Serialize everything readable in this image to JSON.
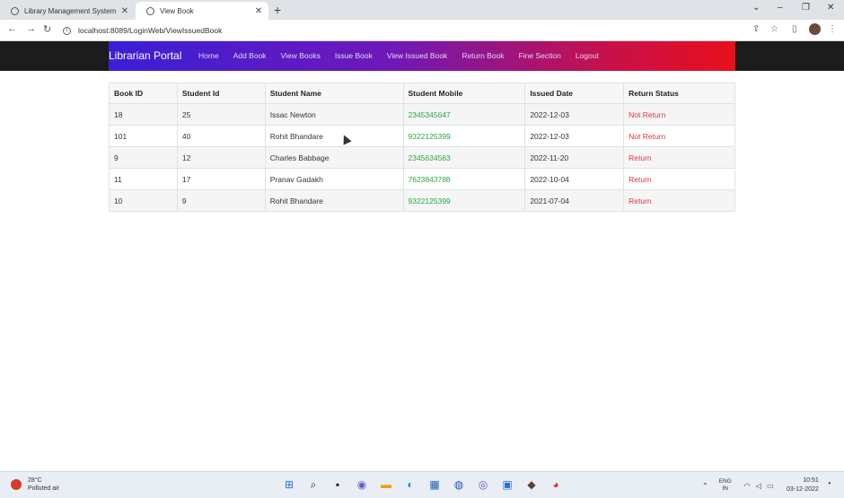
{
  "browser": {
    "tabs": [
      {
        "title": "Library Management System",
        "active": false
      },
      {
        "title": "View Book",
        "active": true
      }
    ],
    "url": "localhost:8089/LoginWeb/ViewIssuedBook"
  },
  "nav": {
    "brand": "Librarian Portal",
    "links": [
      "Home",
      "Add Book",
      "View Books",
      "Issue Book",
      "View Issued Book",
      "Return Book",
      "Fine Section",
      "Logout"
    ]
  },
  "table": {
    "headers": [
      "Book ID",
      "Student Id",
      "Student Name",
      "Student Mobile",
      "Issued Date",
      "Return Status"
    ],
    "rows": [
      [
        "18",
        "25",
        "Issac Newton",
        "2345345647",
        "2022-12-03",
        "Not Return"
      ],
      [
        "101",
        "40",
        "Rohit Bhandare",
        "9322125399",
        "2022-12-03",
        "Not Return"
      ],
      [
        "9",
        "12",
        "Charles Babbage",
        "2345634563",
        "2022-11-20",
        "Return"
      ],
      [
        "11",
        "17",
        "Pranav Gadakh",
        "7623843788",
        "2022-10-04",
        "Return"
      ],
      [
        "10",
        "9",
        "Rohit Bhandare",
        "9322125399",
        "2021-07-04",
        "Return"
      ]
    ]
  },
  "colors": {
    "mobile": "#28a745",
    "status": "#dc3545",
    "nav_gradient_start": "#3a1fd6",
    "nav_gradient_end": "#e8101c"
  },
  "taskbar": {
    "temperature": "28°C",
    "weather": "Polluted air",
    "lang_top": "ENG",
    "lang_bottom": "IN",
    "time": "10:51",
    "date": "03-12-2022"
  }
}
